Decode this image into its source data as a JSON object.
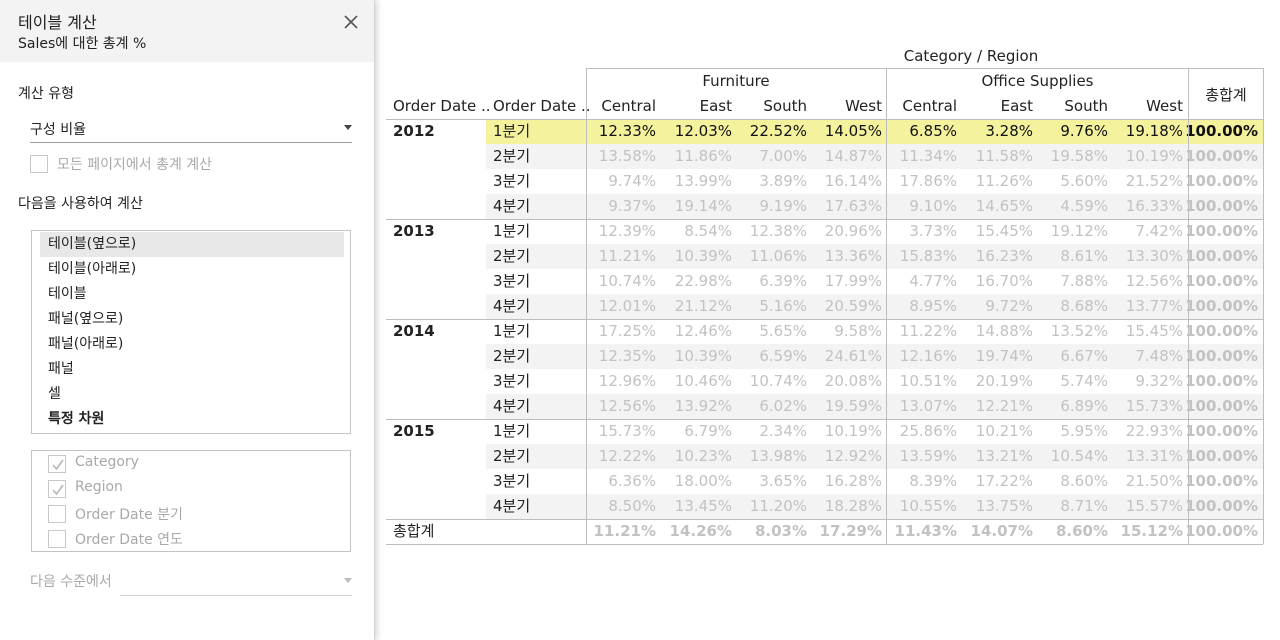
{
  "panel": {
    "title": "테이블 계산",
    "subtitle": "Sales에 대한 총계 %",
    "close_icon": "close-icon",
    "calc_type_label": "계산 유형",
    "calc_type_value": "구성 비율",
    "all_pages_label": "모든 페이지에서 총계 계산",
    "all_pages_checked": false,
    "compute_using_label": "다음을 사용하여 계산",
    "compute_using_items": [
      {
        "label": "테이블(옆으로)",
        "selected": true
      },
      {
        "label": "테이블(아래로)",
        "selected": false
      },
      {
        "label": "테이블",
        "selected": false
      },
      {
        "label": "패널(옆으로)",
        "selected": false
      },
      {
        "label": "패널(아래로)",
        "selected": false
      },
      {
        "label": "패널",
        "selected": false
      },
      {
        "label": "셀",
        "selected": false
      },
      {
        "label": "특정 차원",
        "selected": false
      }
    ],
    "dimensions": [
      {
        "label": "Category",
        "checked": true
      },
      {
        "label": "Region",
        "checked": true
      },
      {
        "label": "Order Date 분기",
        "checked": false
      },
      {
        "label": "Order Date 연도",
        "checked": false
      }
    ],
    "level_label": "다음 수준에서",
    "level_value": ""
  },
  "table": {
    "column_header_title": "Category / Region",
    "row_headers": [
      "Order Date ..",
      "Order Date .."
    ],
    "categories": [
      {
        "name": "Furniture",
        "regions": [
          "Central",
          "East",
          "South",
          "West"
        ]
      },
      {
        "name": "Office Supplies",
        "regions": [
          "Central",
          "East",
          "South",
          "West"
        ]
      }
    ],
    "grand_total_label": "총합계",
    "highlight_color": "#f5f29e",
    "rows": [
      {
        "year": "2012",
        "quarter": "1분기",
        "values": [
          "12.33%",
          "12.03%",
          "22.52%",
          "14.05%",
          "6.85%",
          "3.28%",
          "9.76%",
          "19.18%"
        ],
        "total": "100.00%",
        "active": true
      },
      {
        "year": "",
        "quarter": "2분기",
        "values": [
          "13.58%",
          "11.86%",
          "7.00%",
          "14.87%",
          "11.34%",
          "11.58%",
          "19.58%",
          "10.19%"
        ],
        "total": "100.00%",
        "active": false
      },
      {
        "year": "",
        "quarter": "3분기",
        "values": [
          "9.74%",
          "13.99%",
          "3.89%",
          "16.14%",
          "17.86%",
          "11.26%",
          "5.60%",
          "21.52%"
        ],
        "total": "100.00%",
        "active": false
      },
      {
        "year": "",
        "quarter": "4분기",
        "values": [
          "9.37%",
          "19.14%",
          "9.19%",
          "17.63%",
          "9.10%",
          "14.65%",
          "4.59%",
          "16.33%"
        ],
        "total": "100.00%",
        "active": false
      },
      {
        "year": "2013",
        "quarter": "1분기",
        "values": [
          "12.39%",
          "8.54%",
          "12.38%",
          "20.96%",
          "3.73%",
          "15.45%",
          "19.12%",
          "7.42%"
        ],
        "total": "100.00%",
        "active": false
      },
      {
        "year": "",
        "quarter": "2분기",
        "values": [
          "11.21%",
          "10.39%",
          "11.06%",
          "13.36%",
          "15.83%",
          "16.23%",
          "8.61%",
          "13.30%"
        ],
        "total": "100.00%",
        "active": false
      },
      {
        "year": "",
        "quarter": "3분기",
        "values": [
          "10.74%",
          "22.98%",
          "6.39%",
          "17.99%",
          "4.77%",
          "16.70%",
          "7.88%",
          "12.56%"
        ],
        "total": "100.00%",
        "active": false
      },
      {
        "year": "",
        "quarter": "4분기",
        "values": [
          "12.01%",
          "21.12%",
          "5.16%",
          "20.59%",
          "8.95%",
          "9.72%",
          "8.68%",
          "13.77%"
        ],
        "total": "100.00%",
        "active": false
      },
      {
        "year": "2014",
        "quarter": "1분기",
        "values": [
          "17.25%",
          "12.46%",
          "5.65%",
          "9.58%",
          "11.22%",
          "14.88%",
          "13.52%",
          "15.45%"
        ],
        "total": "100.00%",
        "active": false
      },
      {
        "year": "",
        "quarter": "2분기",
        "values": [
          "12.35%",
          "10.39%",
          "6.59%",
          "24.61%",
          "12.16%",
          "19.74%",
          "6.67%",
          "7.48%"
        ],
        "total": "100.00%",
        "active": false
      },
      {
        "year": "",
        "quarter": "3분기",
        "values": [
          "12.96%",
          "10.46%",
          "10.74%",
          "20.08%",
          "10.51%",
          "20.19%",
          "5.74%",
          "9.32%"
        ],
        "total": "100.00%",
        "active": false
      },
      {
        "year": "",
        "quarter": "4분기",
        "values": [
          "12.56%",
          "13.92%",
          "6.02%",
          "19.59%",
          "13.07%",
          "12.21%",
          "6.89%",
          "15.73%"
        ],
        "total": "100.00%",
        "active": false
      },
      {
        "year": "2015",
        "quarter": "1분기",
        "values": [
          "15.73%",
          "6.79%",
          "2.34%",
          "10.19%",
          "25.86%",
          "10.21%",
          "5.95%",
          "22.93%"
        ],
        "total": "100.00%",
        "active": false
      },
      {
        "year": "",
        "quarter": "2분기",
        "values": [
          "12.22%",
          "10.23%",
          "13.98%",
          "12.92%",
          "13.59%",
          "13.21%",
          "10.54%",
          "13.31%"
        ],
        "total": "100.00%",
        "active": false
      },
      {
        "year": "",
        "quarter": "3분기",
        "values": [
          "6.36%",
          "18.00%",
          "3.65%",
          "16.28%",
          "8.39%",
          "17.22%",
          "8.60%",
          "21.50%"
        ],
        "total": "100.00%",
        "active": false
      },
      {
        "year": "",
        "quarter": "4분기",
        "values": [
          "8.50%",
          "13.45%",
          "11.20%",
          "18.28%",
          "10.55%",
          "13.75%",
          "8.71%",
          "15.57%"
        ],
        "total": "100.00%",
        "active": false
      }
    ],
    "grand_total_row": {
      "values": [
        "11.21%",
        "14.26%",
        "8.03%",
        "17.29%",
        "11.43%",
        "14.07%",
        "8.60%",
        "15.12%"
      ],
      "total": "100.00%"
    }
  }
}
